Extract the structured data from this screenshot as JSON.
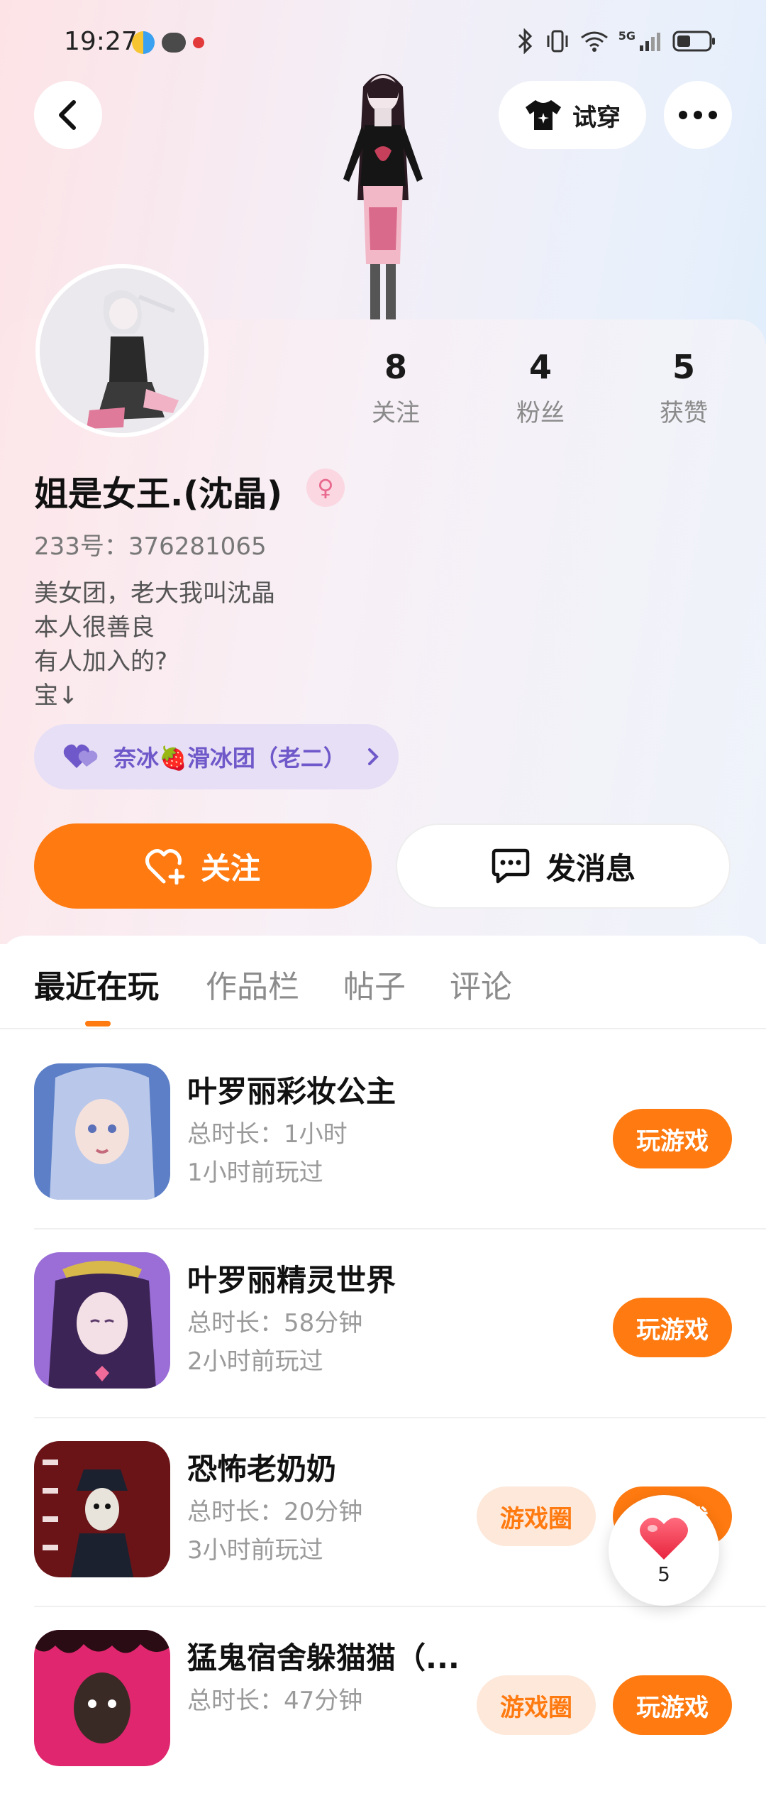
{
  "status_bar": {
    "time": "19:27",
    "network": "5G"
  },
  "header": {
    "tryon_label": "试穿"
  },
  "profile": {
    "stats": [
      {
        "value": "8",
        "label": "关注"
      },
      {
        "value": "4",
        "label": "粉丝"
      },
      {
        "value": "5",
        "label": "获赞"
      }
    ],
    "name": "姐是女王.(沈晶)",
    "gender_symbol": "♀",
    "uid": "233号：376281065",
    "bio": [
      "美女团，老大我叫沈晶",
      "本人很善良",
      "有人加入的?",
      "宝↓"
    ],
    "group": "奈冰🍓滑冰团（老二）",
    "follow_label": "关注",
    "message_label": "发消息"
  },
  "tabs": [
    {
      "label": "最近在玩",
      "active": true
    },
    {
      "label": "作品栏",
      "active": false
    },
    {
      "label": "帖子",
      "active": false
    },
    {
      "label": "评论",
      "active": false
    }
  ],
  "games": [
    {
      "title": "叶罗丽彩妆公主",
      "duration": "总时长：1小时",
      "last_played": "1小时前玩过",
      "play_label": "玩游戏",
      "circle_label": ""
    },
    {
      "title": "叶罗丽精灵世界",
      "duration": "总时长：58分钟",
      "last_played": "2小时前玩过",
      "play_label": "玩游戏",
      "circle_label": ""
    },
    {
      "title": "恐怖老奶奶",
      "duration": "总时长：20分钟",
      "last_played": "3小时前玩过",
      "play_label": "玩游戏",
      "circle_label": "游戏圈"
    },
    {
      "title": "猛鬼宿舍躲猫猫（...",
      "duration": "总时长：47分钟",
      "last_played": "",
      "play_label": "玩游戏",
      "circle_label": "游戏圈"
    }
  ],
  "fab": {
    "heart_count": "5"
  },
  "colors": {
    "accent": "#ff7a10",
    "pill_bg": "#fde8da",
    "group_text": "#6f58c9"
  }
}
